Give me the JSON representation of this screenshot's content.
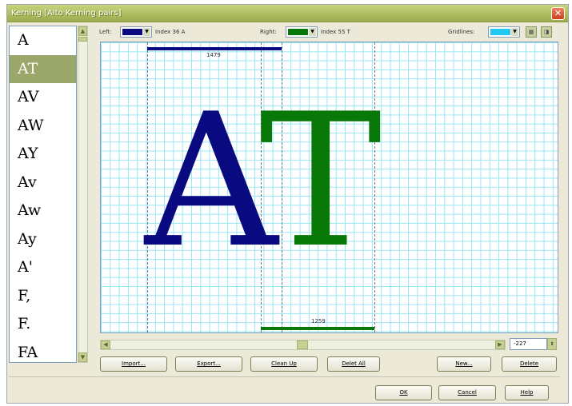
{
  "window": {
    "title": "Kerning [Alto Kerning pairs]"
  },
  "pairs": [
    "A",
    "AT",
    "AV",
    "AW",
    "AY",
    "Av",
    "Aw",
    "Ay",
    "A'",
    "F,",
    "F.",
    "FA"
  ],
  "selected_pair": "AT",
  "left": {
    "label": "Left:",
    "color": "#0a0a80",
    "index_text": "Index 36 A"
  },
  "right": {
    "label": "Right:",
    "color": "#087808",
    "index_text": "Index 55 T"
  },
  "gridlines": {
    "label": "Gridlines:",
    "color": "#22c8f0"
  },
  "canvas": {
    "left_glyph": "A",
    "right_glyph": "T",
    "left_width": "1479",
    "right_width": "1259",
    "grid_color": "#99e6f5"
  },
  "kerning_value": "-227",
  "buttons": {
    "import": "Import...",
    "export": "Export...",
    "clean_up": "Clean Up",
    "delete_all": "Delet All",
    "new": "New...",
    "delete": "Delete",
    "ok": "OK",
    "cancel": "Cancel",
    "help": "Help"
  }
}
